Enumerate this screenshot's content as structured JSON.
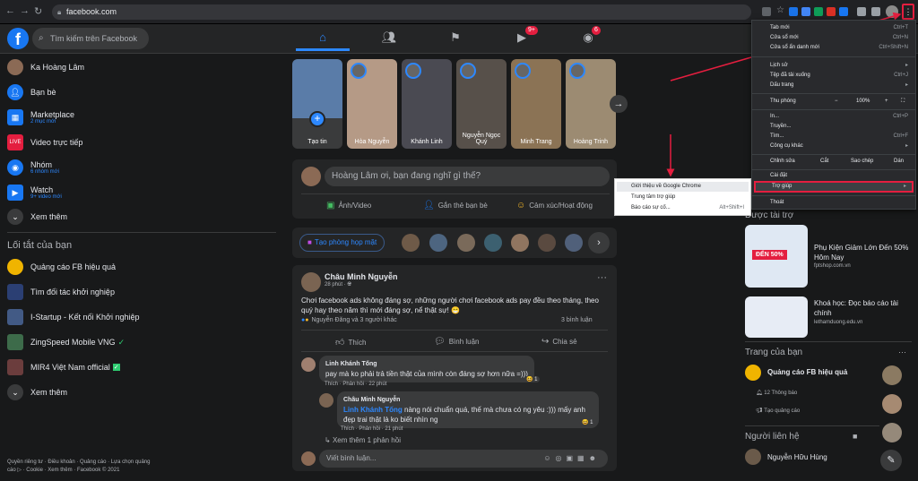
{
  "browser": {
    "url": "facebook.com"
  },
  "header": {
    "search_placeholder": "Tìm kiếm trên Facebook",
    "video_badge": "9+",
    "groups_badge": "6"
  },
  "sidebar": {
    "items": [
      {
        "label": "Ka Hoàng Lâm",
        "sub": ""
      },
      {
        "label": "Bạn bè",
        "sub": ""
      },
      {
        "label": "Marketplace",
        "sub": "2 mục mới"
      },
      {
        "label": "Video trực tiếp",
        "sub": ""
      },
      {
        "label": "Nhóm",
        "sub": "6 nhóm mới"
      },
      {
        "label": "Watch",
        "sub": "9+ video mới"
      },
      {
        "label": "Xem thêm",
        "sub": ""
      }
    ],
    "shortcuts_title": "Lối tắt của bạn",
    "shortcuts": [
      "Quảng cáo FB hiệu quả",
      "Tìm đối tác khởi nghiệp",
      "I-Startup - Kết nối Khởi nghiệp",
      "ZingSpeed Mobile VNG",
      "MIR4 Việt Nam official",
      "Xem thêm"
    ],
    "footer": "Quyền riêng tư · Điều khoản · Quảng cáo · Lựa chọn quảng cáo ▷ · Cookie · Xem thêm · Facebook © 2021"
  },
  "stories": [
    {
      "name": "Tạo tin"
    },
    {
      "name": "Hòa Nguyễn"
    },
    {
      "name": "Khánh Linh"
    },
    {
      "name": "Nguyễn Ngọc Quý"
    },
    {
      "name": "Minh Trang"
    },
    {
      "name": "Hoàng Trinh"
    }
  ],
  "composer": {
    "placeholder": "Hoàng Lâm ơi, bạn đang nghĩ gì thế?",
    "photo": "Ảnh/Video",
    "tag": "Gắn thẻ bạn bè",
    "feeling": "Cảm xúc/Hoạt động"
  },
  "rooms": {
    "label": "Tạo phòng họp mặt"
  },
  "post": {
    "author": "Châu Minh Nguyễn",
    "time": "28 phút · ",
    "text": "Chơi facebook ads không đáng sợ, những người chơi facebook ads pay đều theo tháng, theo quý hay theo năm thì mới đáng sợ, nể thật sự! 😁",
    "reactions": "Nguyễn Đăng và 3 người khác",
    "comments_count": "3 bình luận",
    "like": "Thích",
    "comment": "Bình luận",
    "share": "Chia sẻ",
    "c1_author": "Linh Khánh Tống",
    "c1_text": "pay mà ko phải trả tiền thật của mình còn đáng sợ hơn nữa =)))",
    "c1_meta": "Thích · Phản hồi · 22 phút",
    "c2_author": "Châu Minh Nguyễn",
    "c2_mention": "Linh Khánh Tống",
    "c2_text": " nàng nói chuẩn quá, thế mà chưa có ng yêu :))) mấy anh đẹp trai thật là ko biết nhìn ng",
    "c2_meta": "Thích · Phản hồi · 21 phút",
    "more_replies": "Xem thêm 1 phản hồi",
    "write_placeholder": "Viết bình luận..."
  },
  "right": {
    "sponsored": "Được tài trợ",
    "ad1_title": "Phụ Kiện Giảm Lớn Đến 50% Hôm Nay",
    "ad1_site": "fptshop.com.vn",
    "ad1_img": "ĐẾN 50%",
    "ad2_title": "Khoá học: Đọc báo cáo tài chính",
    "ad2_site": "lethamduong.edu.vn",
    "pages_title": "Trang của bạn",
    "page_name": "Quảng cáo FB hiệu quả",
    "notifications": "12 Thông báo",
    "create_ad": "Tạo quảng cáo",
    "contacts_title": "Người liên hệ",
    "contact1": "Nguyễn Hữu Hùng"
  },
  "menu": {
    "items": [
      {
        "label": "Tab mới",
        "sc": "Ctrl+T"
      },
      {
        "label": "Cửa sổ mới",
        "sc": "Ctrl+N"
      },
      {
        "label": "Cửa sổ ẩn danh mới",
        "sc": "Ctrl+Shift+N"
      },
      {
        "label": "Lịch sử",
        "sc": "▸"
      },
      {
        "label": "Tệp đã tải xuống",
        "sc": "Ctrl+J"
      },
      {
        "label": "Dấu trang",
        "sc": "▸"
      },
      {
        "label": "Thu phóng",
        "sc": ""
      },
      {
        "label": "In...",
        "sc": "Ctrl+P"
      },
      {
        "label": "Truyền...",
        "sc": ""
      },
      {
        "label": "Tìm...",
        "sc": "Ctrl+F"
      },
      {
        "label": "Công cụ khác",
        "sc": "▸"
      },
      {
        "label": "Chỉnh sửa",
        "sc": ""
      },
      {
        "label": "Cài đặt",
        "sc": ""
      },
      {
        "label": "Trợ giúp",
        "sc": "▸"
      },
      {
        "label": "Thoát",
        "sc": ""
      }
    ],
    "zoom": "100%",
    "zoom_minus": "−",
    "zoom_plus": "+",
    "cut": "Cắt",
    "copy": "Sao chép",
    "paste": "Dán"
  },
  "submenu": {
    "items": [
      {
        "label": "Giới thiệu về Google Chrome",
        "sc": ""
      },
      {
        "label": "Trung tâm trợ giúp",
        "sc": ""
      },
      {
        "label": "Báo cáo sự cố...",
        "sc": "Alt+Shift+I"
      }
    ]
  },
  "colors": {
    "accent": "#2d88ff",
    "highlight": "#e41e3f"
  }
}
